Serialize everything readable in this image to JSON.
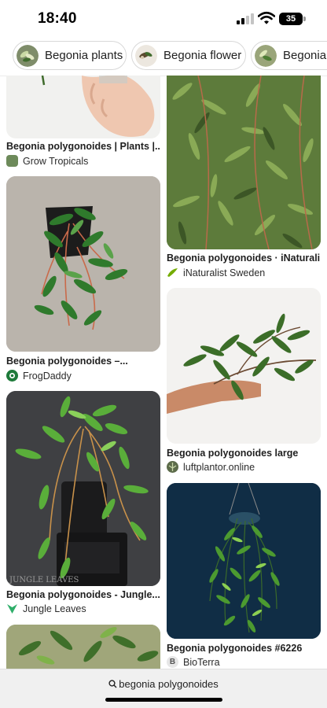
{
  "status_bar": {
    "time": "18:40",
    "battery": "35"
  },
  "chips": [
    {
      "label": "Begonia plants",
      "icon": "plant-thumbnail"
    },
    {
      "label": "Begonia flower",
      "icon": "flower-thumbnail"
    },
    {
      "label": "Begonia f",
      "icon": "plant-thumbnail"
    }
  ],
  "results": [
    {
      "title": "Begonia polygonoides | Plants |...",
      "source": "Grow Tropicals",
      "favicon_color": "#6d8a5a"
    },
    {
      "title": "Begonia polygonoides · iNaturali...",
      "source": "iNaturalist Sweden",
      "favicon_color": "#74ac00"
    },
    {
      "title": "Begonia polygonoides –...",
      "source": "FrogDaddy",
      "favicon_color": "#1e7a3a"
    },
    {
      "title": "Begonia polygonoides large",
      "source": "luftplantor.online",
      "favicon_color": "#5c6b4a"
    },
    {
      "title": "Begonia polygonoides - Jungle...",
      "source": "Jungle Leaves",
      "favicon_color": "#2fae6a",
      "watermark": "JUNGLE LEAVES"
    },
    {
      "title": "Begonia polygonoides #6226",
      "source": "BioTerra",
      "favicon_color": "#e6e6e6",
      "favicon_letter": "B"
    }
  ],
  "search": {
    "query": "begonia polygonoides"
  }
}
